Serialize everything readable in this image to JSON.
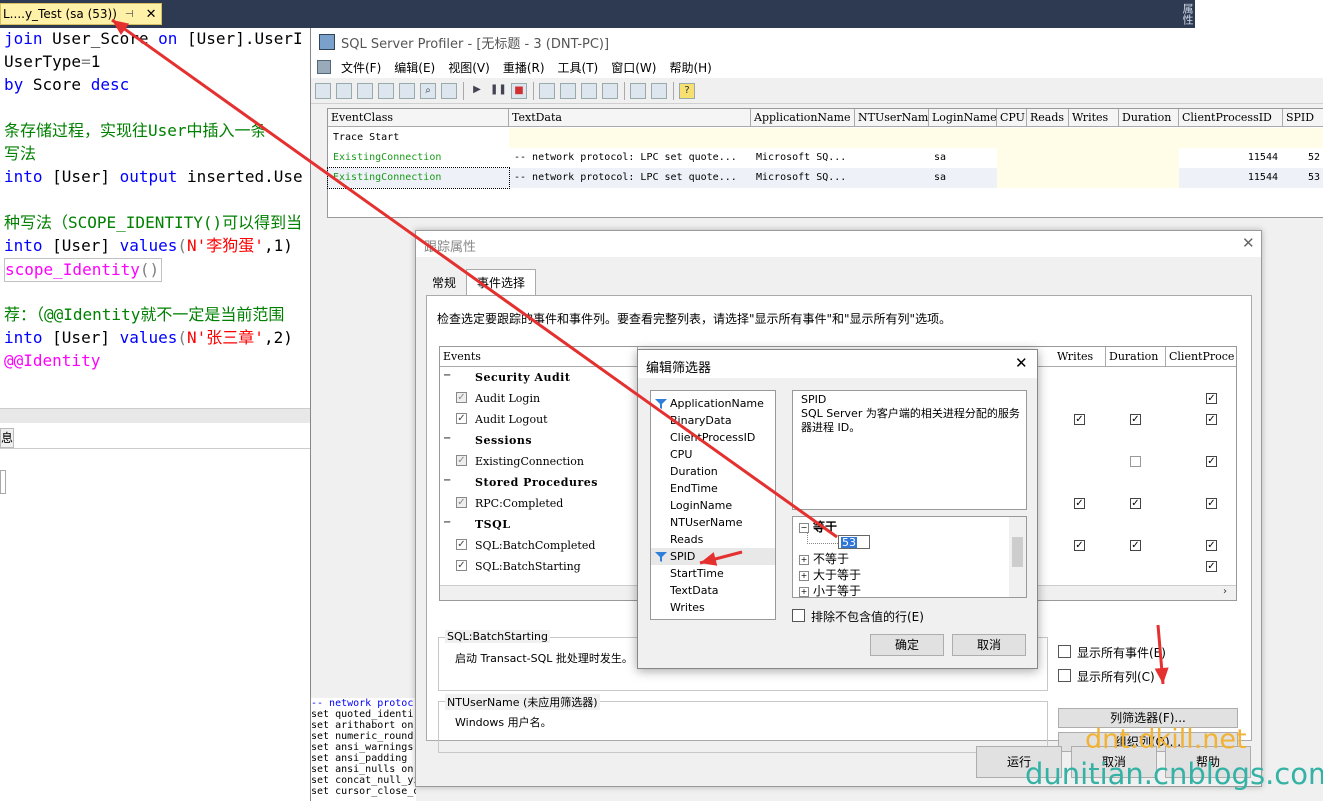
{
  "ssms": {
    "tab_title": "L....y_Test (sa (53))",
    "pin_glyph": "☐",
    "close_glyph": "✕",
    "right_strip_label": "属性",
    "code_lines": [
      {
        "segments": [
          {
            "t": "join",
            "c": "kw"
          },
          {
            "t": " User_Score ",
            "c": ""
          },
          {
            "t": "on",
            "c": "kw"
          },
          {
            "t": " [User].UserI",
            "c": ""
          }
        ]
      },
      {
        "segments": [
          {
            "t": "UserType",
            "c": ""
          },
          {
            "t": "=",
            "c": "gr"
          },
          {
            "t": "1",
            "c": ""
          }
        ]
      },
      {
        "segments": [
          {
            "t": "by",
            "c": "kw"
          },
          {
            "t": " Score ",
            "c": ""
          },
          {
            "t": "desc",
            "c": "kw"
          }
        ]
      },
      {
        "segments": []
      },
      {
        "segments": [
          {
            "t": "条存储过程，实现往User中插入一条",
            "c": "cm"
          }
        ]
      },
      {
        "segments": [
          {
            "t": "写法",
            "c": "cm"
          }
        ]
      },
      {
        "segments": [
          {
            "t": "into",
            "c": "kw"
          },
          {
            "t": " [User] ",
            "c": ""
          },
          {
            "t": "output",
            "c": "kw"
          },
          {
            "t": " inserted.Use",
            "c": ""
          }
        ]
      },
      {
        "segments": []
      },
      {
        "segments": [
          {
            "t": "种写法（SCOPE_IDENTITY()可以得到当",
            "c": "cm"
          }
        ]
      },
      {
        "segments": [
          {
            "t": "into",
            "c": "kw"
          },
          {
            "t": " [User] ",
            "c": ""
          },
          {
            "t": "values",
            "c": "kw"
          },
          {
            "t": "(",
            "c": "gr"
          },
          {
            "t": "N'李狗蛋'",
            "c": "st"
          },
          {
            "t": ",1)",
            "c": ""
          }
        ]
      },
      {
        "segments": [
          {
            "t": "scope_Identity",
            "c": "fn"
          },
          {
            "t": "()",
            "c": "gr"
          }
        ]
      },
      {
        "segments": []
      },
      {
        "segments": [
          {
            "t": "荐：（@@Identity就不一定是当前范围",
            "c": "cm"
          }
        ]
      },
      {
        "segments": [
          {
            "t": "into",
            "c": "kw"
          },
          {
            "t": " [User] ",
            "c": ""
          },
          {
            "t": "values",
            "c": "kw"
          },
          {
            "t": "(",
            "c": "gr"
          },
          {
            "t": "N'张三章'",
            "c": "st"
          },
          {
            "t": ",2)",
            "c": ""
          }
        ]
      },
      {
        "segments": [
          {
            "t": "@@Identity",
            "c": "fn"
          }
        ]
      }
    ],
    "messages_tab": "息"
  },
  "profiler": {
    "title": "SQL Server Profiler - [无标题 - 3 (DNT-PC)]",
    "menu": [
      "文件(F)",
      "编辑(E)",
      "视图(V)",
      "重播(R)",
      "工具(T)",
      "窗口(W)",
      "帮助(H)"
    ],
    "toolbar_icons": [
      "new-trace-icon",
      "open-icon",
      "open-template-icon",
      "save-icon",
      "properties-icon",
      "find-icon",
      "clear-icon",
      "run-icon",
      "pause-icon",
      "stop-icon",
      "cascade-icon",
      "tile-horizontal-icon",
      "tile-vertical-icon",
      "scroll-icon",
      "performance-icon",
      "activity-icon",
      "help-icon"
    ],
    "trace_columns": [
      "EventClass",
      "TextData",
      "ApplicationName",
      "NTUserName",
      "LoginName",
      "CPU",
      "Reads",
      "Writes",
      "Duration",
      "ClientProcessID",
      "SPID"
    ],
    "trace_rows": [
      {
        "EventClass": "Trace Start",
        "TextData": "",
        "ApplicationName": "",
        "NTUserName": "",
        "LoginName": "",
        "ClientProcessID": "",
        "SPID": ""
      },
      {
        "EventClass": "ExistingConnection",
        "TextData": "-- network protocol: LPC  set quote...",
        "ApplicationName": "Microsoft SQ...",
        "NTUserName": "",
        "LoginName": "sa",
        "ClientProcessID": "11544",
        "SPID": "52"
      },
      {
        "EventClass": "ExistingConnection",
        "TextData": "-- network protocol: LPC  set quote...",
        "ApplicationName": "Microsoft SQ...",
        "NTUserName": "",
        "LoginName": "sa",
        "ClientProcessID": "11544",
        "SPID": "53"
      }
    ],
    "sql_text_lines": [
      {
        "k": "-- network protoc",
        "c": "sqk"
      },
      {
        "k": "set quoted_identi",
        "c": ""
      },
      {
        "k": "set arithabort on",
        "c": ""
      },
      {
        "k": "set numeric_round",
        "c": ""
      },
      {
        "k": "set ansi_warnings",
        "c": ""
      },
      {
        "k": "set ansi_padding",
        "c": ""
      },
      {
        "k": "set ansi_nulls on",
        "c": ""
      },
      {
        "k": "set concat_null_yields_null on",
        "c": ""
      },
      {
        "k": "set cursor_close_on_commit off",
        "c": ""
      }
    ]
  },
  "trace_props": {
    "title": "跟踪属性",
    "close_glyph": "✕",
    "tabs": [
      "常规",
      "事件选择"
    ],
    "instructions": "检查选定要跟踪的事件和事件列。要查看完整列表，请选择\"显示所有事件\"和\"显示所有列\"选项。",
    "event_columns": [
      "Events",
      "s",
      "Writes",
      "Duration",
      "ClientProce"
    ],
    "event_rows": [
      {
        "kind": "cat",
        "label": "Security Audit",
        "box": "−"
      },
      {
        "kind": "evt",
        "label": "Audit Login",
        "checked": true,
        "gray": true,
        "cols": [
          false,
          false,
          true
        ]
      },
      {
        "kind": "evt",
        "label": "Audit Logout",
        "checked": true,
        "gray": false,
        "cols": [
          true,
          true,
          true
        ]
      },
      {
        "kind": "cat",
        "label": "Sessions",
        "box": "−"
      },
      {
        "kind": "evt",
        "label": "ExistingConnection",
        "checked": true,
        "gray": true,
        "cols": [
          false,
          "off",
          true
        ]
      },
      {
        "kind": "cat",
        "label": "Stored Procedures",
        "box": "−"
      },
      {
        "kind": "evt",
        "label": "RPC:Completed",
        "checked": true,
        "gray": true,
        "cols": [
          true,
          true,
          true
        ]
      },
      {
        "kind": "cat",
        "label": "TSQL",
        "box": "−"
      },
      {
        "kind": "evt",
        "label": "SQL:BatchCompleted",
        "checked": true,
        "gray": false,
        "cols": [
          true,
          true,
          true
        ]
      },
      {
        "kind": "evt",
        "label": "SQL:BatchStarting",
        "checked": true,
        "gray": false,
        "cols": [
          false,
          false,
          true
        ]
      }
    ],
    "event_desc_title": "SQL:BatchStarting",
    "event_desc_text": "启动 Transact-SQL 批处理时发生。",
    "column_desc_title": "NTUserName (未应用筛选器)",
    "column_desc_text": "Windows 用户名。",
    "show_all_events": "显示所有事件(E)",
    "show_all_columns": "显示所有列(C)",
    "column_filters_button": "列筛选器(F)...",
    "organize_columns_button": "组织列(O)...",
    "run_button": "运行",
    "cancel_button": "取消",
    "help_button": "帮助"
  },
  "edit_filter": {
    "title": "编辑筛选器",
    "close_glyph": "✕",
    "columns": [
      {
        "name": "ApplicationName",
        "filtered": true
      },
      {
        "name": "BinaryData",
        "filtered": false
      },
      {
        "name": "ClientProcessID",
        "filtered": false
      },
      {
        "name": "CPU",
        "filtered": false
      },
      {
        "name": "Duration",
        "filtered": false
      },
      {
        "name": "EndTime",
        "filtered": false
      },
      {
        "name": "LoginName",
        "filtered": false
      },
      {
        "name": "NTUserName",
        "filtered": false
      },
      {
        "name": "Reads",
        "filtered": false
      },
      {
        "name": "SPID",
        "filtered": true,
        "selected": true
      },
      {
        "name": "StartTime",
        "filtered": false
      },
      {
        "name": "TextData",
        "filtered": false
      },
      {
        "name": "Writes",
        "filtered": false
      }
    ],
    "desc_title": "SPID",
    "desc_text": "SQL Server 为客户端的相关进程分配的服务器进程 ID。",
    "operators": [
      {
        "label": "等于",
        "box": "−",
        "expanded": true
      },
      {
        "label": "不等于",
        "box": "+"
      },
      {
        "label": "大于等于",
        "box": "+"
      },
      {
        "label": "小于等于",
        "box": "+"
      }
    ],
    "filter_value": "53",
    "exclude_label": "排除不包含值的行(E)",
    "ok_button": "确定",
    "cancel_button": "取消"
  },
  "watermark": {
    "line1": "dnt.dkill.net",
    "line2": "dunitian.cnblogs.com"
  },
  "colors": {
    "annotation_arrow": "#e53030",
    "ssms_titlebar": "#2d3a52",
    "tab_highlight": "#fff1a8"
  }
}
